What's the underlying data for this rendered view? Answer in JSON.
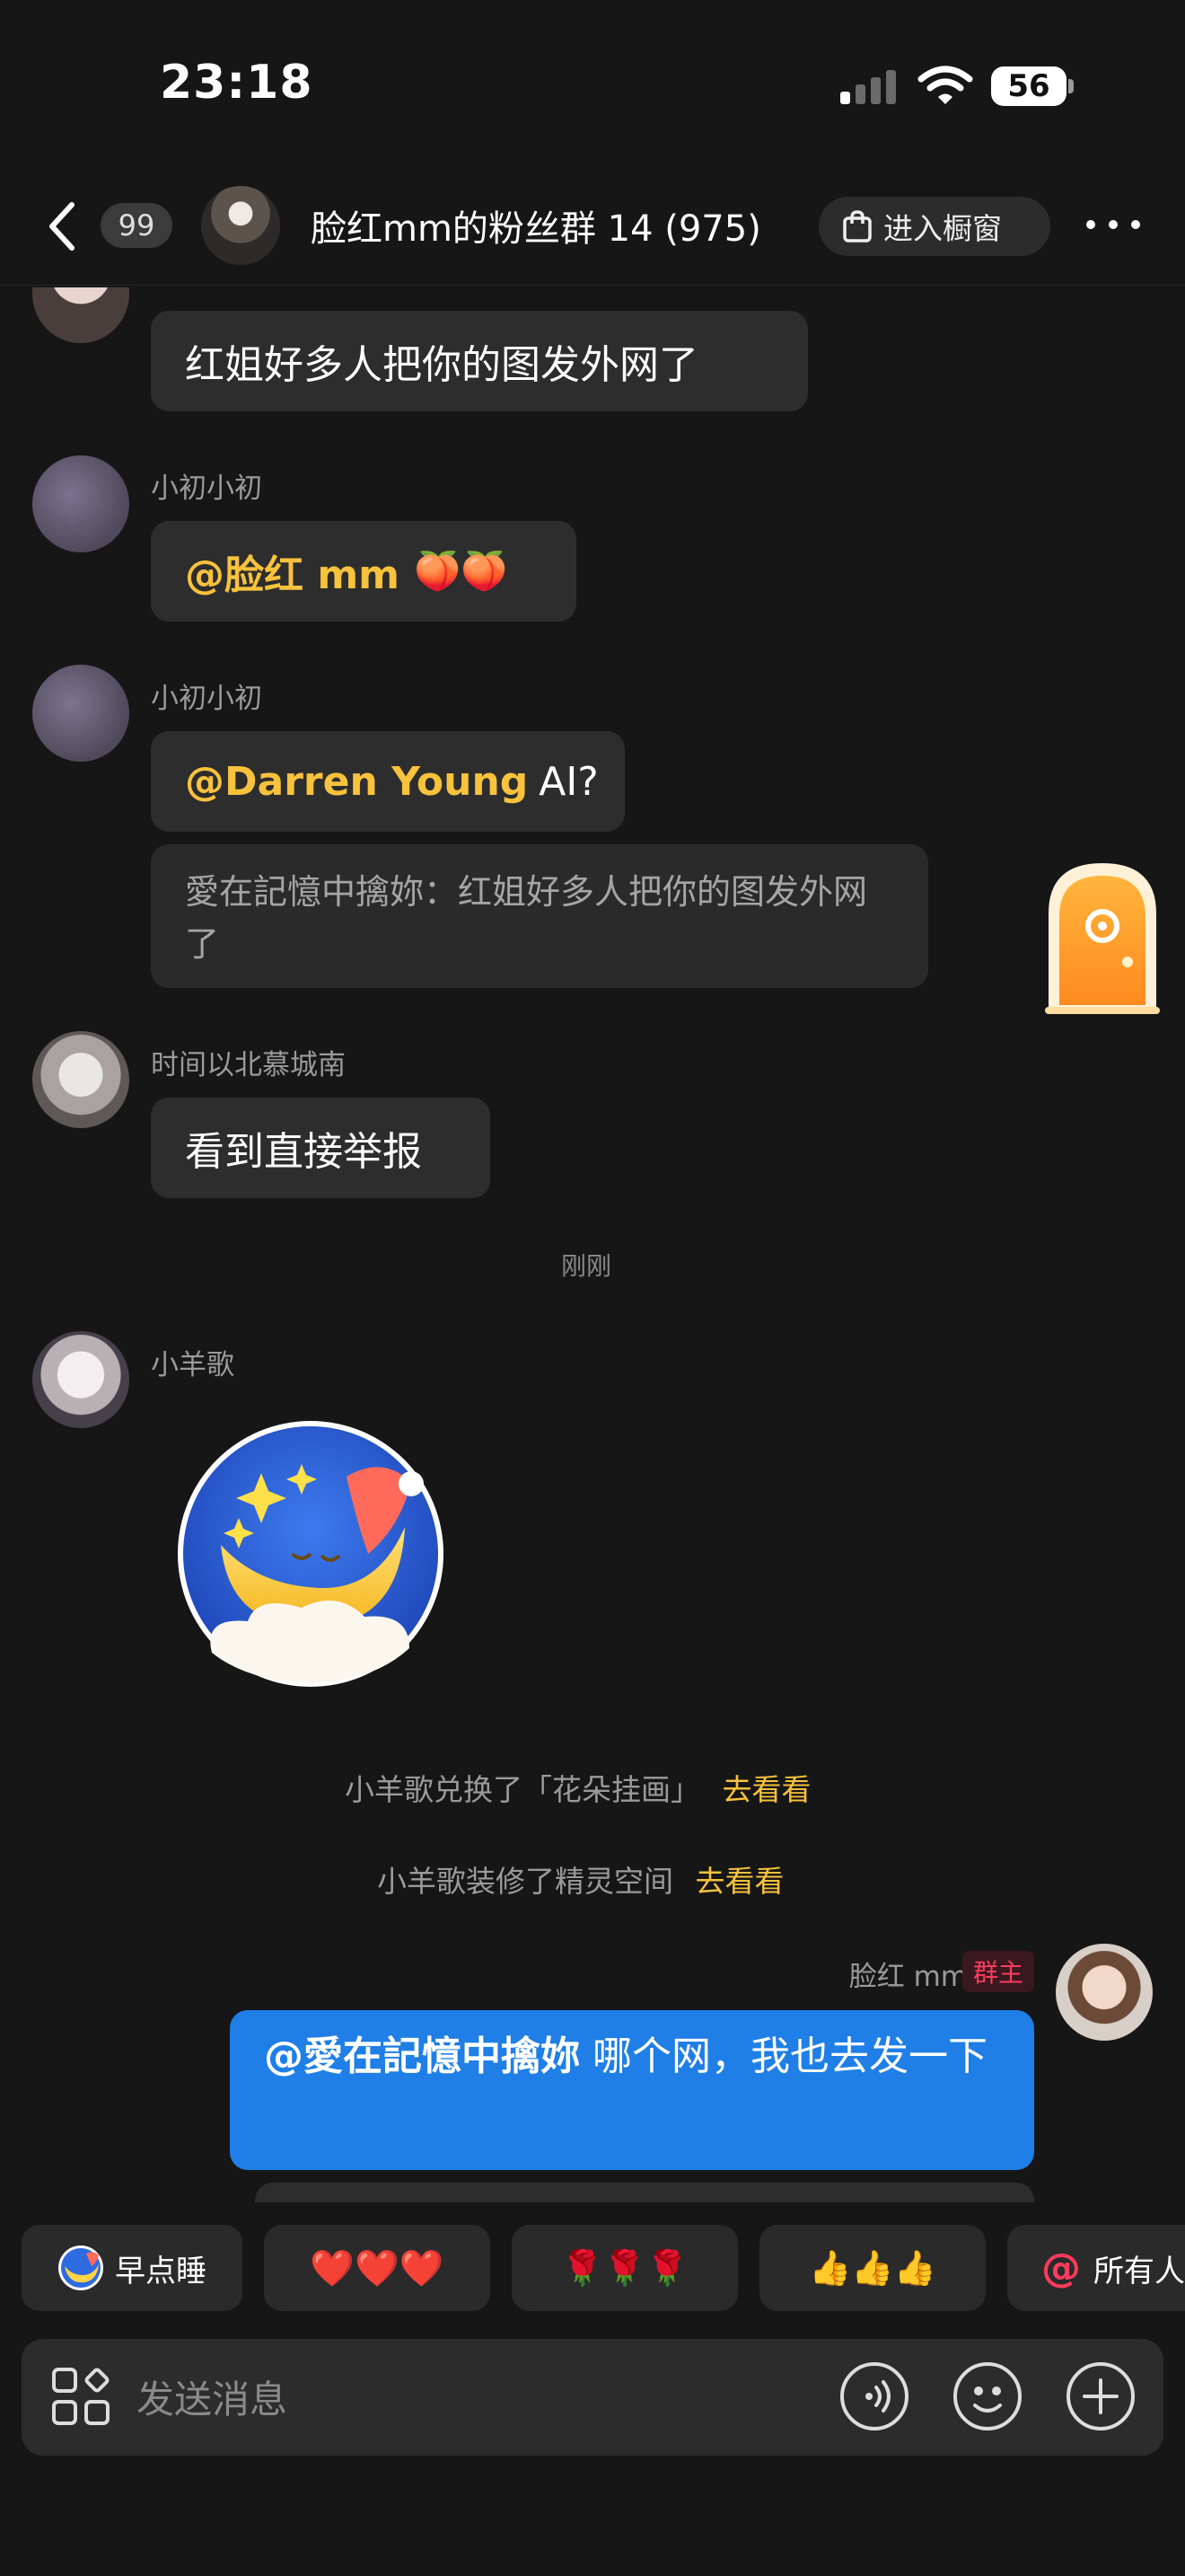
{
  "status_bar": {
    "time": "23:18",
    "battery": "56"
  },
  "header": {
    "unread_count": "99",
    "group_title": "脸红mm的粉丝群 14 (975)",
    "showcase_label": "进入橱窗"
  },
  "messages": {
    "m1": {
      "text": "红姐好多人把你的图发外网了"
    },
    "m2": {
      "nick": "小初小初",
      "mention": "@脸红 mm",
      "emoji": "🍑🍑"
    },
    "m3": {
      "nick": "小初小初",
      "mention": "@Darren Young",
      "text": "AI?",
      "quote": "愛在記憶中擒妳：红姐好多人把你的图发外网了"
    },
    "m4": {
      "nick": "时间以北慕城南",
      "text": "看到直接举报"
    },
    "timestamp": "刚刚",
    "m5": {
      "nick": "小羊歌"
    },
    "sys1": {
      "text": "小羊歌兑换了「花朵挂画」",
      "link": "去看看"
    },
    "sys2": {
      "text": "小羊歌装修了精灵空间",
      "link": "去看看"
    },
    "owner": {
      "nick": "脸红 mm",
      "badge": "群主",
      "mention": "@愛在記憶中擒妳",
      "text": " 哪个网，我也去发一下"
    }
  },
  "quick_replies": [
    {
      "label": "早点睡",
      "icon": "moon-icon"
    },
    {
      "label": "❤️❤️❤️"
    },
    {
      "label": "🌹🌹🌹"
    },
    {
      "label": "👍👍👍"
    },
    {
      "label": "所有人",
      "icon": "at-icon"
    }
  ],
  "input": {
    "placeholder": "发送消息"
  },
  "colors": {
    "accent_yellow": "#f7c23c",
    "bubble_blue": "#1f7fe6",
    "owner_badge": "#ff3c5c",
    "background": "#161616"
  }
}
